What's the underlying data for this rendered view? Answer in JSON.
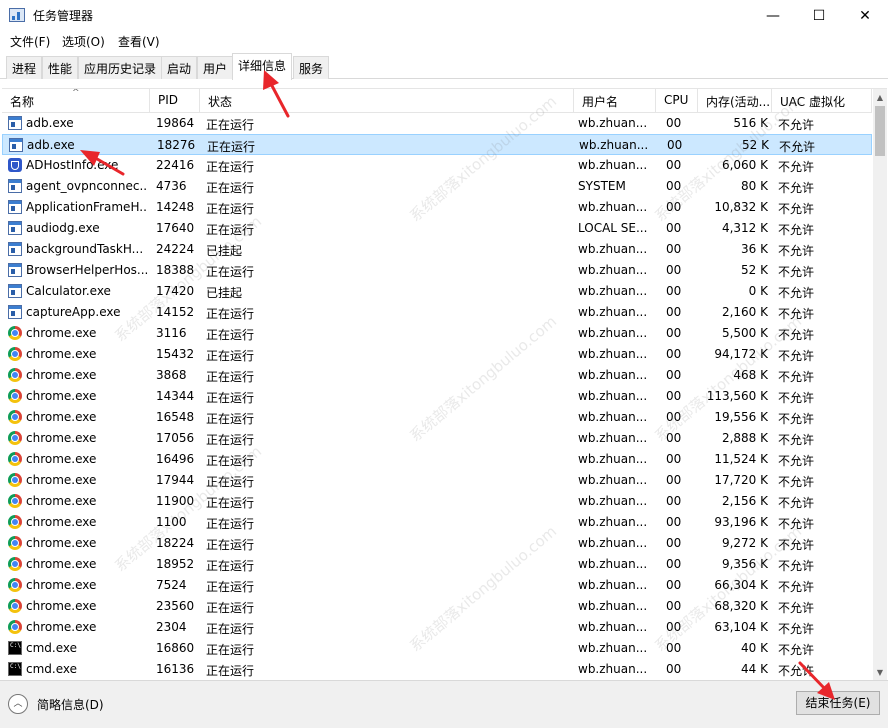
{
  "window": {
    "title": "任务管理器",
    "minimize_glyph": "—",
    "maximize_glyph": "☐",
    "close_glyph": "✕"
  },
  "menu": [
    "文件(F)",
    "选项(O)",
    "查看(V)"
  ],
  "tabs": [
    "进程",
    "性能",
    "应用历史记录",
    "启动",
    "用户",
    "详细信息",
    "服务"
  ],
  "active_tab": "详细信息",
  "columns": [
    "名称",
    "PID",
    "状态",
    "用户名",
    "CPU",
    "内存(活动...",
    "UAC 虚拟化"
  ],
  "selected_row": 1,
  "processes": [
    {
      "name": "adb.exe",
      "pid": "19864",
      "status": "正在运行",
      "user": "wb.zhuan...",
      "cpu": "00",
      "mem": "516 K",
      "uac": "不允许",
      "icon": "window-icon"
    },
    {
      "name": "adb.exe",
      "pid": "18276",
      "status": "正在运行",
      "user": "wb.zhuan...",
      "cpu": "00",
      "mem": "52 K",
      "uac": "不允许",
      "icon": "window-icon"
    },
    {
      "name": "ADHostInfo.exe",
      "pid": "22416",
      "status": "正在运行",
      "user": "wb.zhuan...",
      "cpu": "00",
      "mem": "6,060 K",
      "uac": "不允许",
      "icon": "shield-icon"
    },
    {
      "name": "agent_ovpnconnec...",
      "pid": "4736",
      "status": "正在运行",
      "user": "SYSTEM",
      "cpu": "00",
      "mem": "80 K",
      "uac": "不允许",
      "icon": "window-icon"
    },
    {
      "name": "ApplicationFrameH...",
      "pid": "14248",
      "status": "正在运行",
      "user": "wb.zhuan...",
      "cpu": "00",
      "mem": "10,832 K",
      "uac": "不允许",
      "icon": "window-icon"
    },
    {
      "name": "audiodg.exe",
      "pid": "17640",
      "status": "正在运行",
      "user": "LOCAL SE...",
      "cpu": "00",
      "mem": "4,312 K",
      "uac": "不允许",
      "icon": "window-icon"
    },
    {
      "name": "backgroundTaskH...",
      "pid": "24224",
      "status": "已挂起",
      "user": "wb.zhuan...",
      "cpu": "00",
      "mem": "36 K",
      "uac": "不允许",
      "icon": "window-icon"
    },
    {
      "name": "BrowserHelperHos...",
      "pid": "18388",
      "status": "正在运行",
      "user": "wb.zhuan...",
      "cpu": "00",
      "mem": "52 K",
      "uac": "不允许",
      "icon": "window-icon"
    },
    {
      "name": "Calculator.exe",
      "pid": "17420",
      "status": "已挂起",
      "user": "wb.zhuan...",
      "cpu": "00",
      "mem": "0 K",
      "uac": "不允许",
      "icon": "window-icon"
    },
    {
      "name": "captureApp.exe",
      "pid": "14152",
      "status": "正在运行",
      "user": "wb.zhuan...",
      "cpu": "00",
      "mem": "2,160 K",
      "uac": "不允许",
      "icon": "window-icon"
    },
    {
      "name": "chrome.exe",
      "pid": "3116",
      "status": "正在运行",
      "user": "wb.zhuan...",
      "cpu": "00",
      "mem": "5,500 K",
      "uac": "不允许",
      "icon": "chrome-icon"
    },
    {
      "name": "chrome.exe",
      "pid": "15432",
      "status": "正在运行",
      "user": "wb.zhuan...",
      "cpu": "00",
      "mem": "94,172 K",
      "uac": "不允许",
      "icon": "chrome-icon"
    },
    {
      "name": "chrome.exe",
      "pid": "3868",
      "status": "正在运行",
      "user": "wb.zhuan...",
      "cpu": "00",
      "mem": "468 K",
      "uac": "不允许",
      "icon": "chrome-icon"
    },
    {
      "name": "chrome.exe",
      "pid": "14344",
      "status": "正在运行",
      "user": "wb.zhuan...",
      "cpu": "00",
      "mem": "113,560 K",
      "uac": "不允许",
      "icon": "chrome-icon"
    },
    {
      "name": "chrome.exe",
      "pid": "16548",
      "status": "正在运行",
      "user": "wb.zhuan...",
      "cpu": "00",
      "mem": "19,556 K",
      "uac": "不允许",
      "icon": "chrome-icon"
    },
    {
      "name": "chrome.exe",
      "pid": "17056",
      "status": "正在运行",
      "user": "wb.zhuan...",
      "cpu": "00",
      "mem": "2,888 K",
      "uac": "不允许",
      "icon": "chrome-icon"
    },
    {
      "name": "chrome.exe",
      "pid": "16496",
      "status": "正在运行",
      "user": "wb.zhuan...",
      "cpu": "00",
      "mem": "11,524 K",
      "uac": "不允许",
      "icon": "chrome-icon"
    },
    {
      "name": "chrome.exe",
      "pid": "17944",
      "status": "正在运行",
      "user": "wb.zhuan...",
      "cpu": "00",
      "mem": "17,720 K",
      "uac": "不允许",
      "icon": "chrome-icon"
    },
    {
      "name": "chrome.exe",
      "pid": "11900",
      "status": "正在运行",
      "user": "wb.zhuan...",
      "cpu": "00",
      "mem": "2,156 K",
      "uac": "不允许",
      "icon": "chrome-icon"
    },
    {
      "name": "chrome.exe",
      "pid": "1100",
      "status": "正在运行",
      "user": "wb.zhuan...",
      "cpu": "00",
      "mem": "93,196 K",
      "uac": "不允许",
      "icon": "chrome-icon"
    },
    {
      "name": "chrome.exe",
      "pid": "18224",
      "status": "正在运行",
      "user": "wb.zhuan...",
      "cpu": "00",
      "mem": "9,272 K",
      "uac": "不允许",
      "icon": "chrome-icon"
    },
    {
      "name": "chrome.exe",
      "pid": "18952",
      "status": "正在运行",
      "user": "wb.zhuan...",
      "cpu": "00",
      "mem": "9,356 K",
      "uac": "不允许",
      "icon": "chrome-icon"
    },
    {
      "name": "chrome.exe",
      "pid": "7524",
      "status": "正在运行",
      "user": "wb.zhuan...",
      "cpu": "00",
      "mem": "66,304 K",
      "uac": "不允许",
      "icon": "chrome-icon"
    },
    {
      "name": "chrome.exe",
      "pid": "23560",
      "status": "正在运行",
      "user": "wb.zhuan...",
      "cpu": "00",
      "mem": "68,320 K",
      "uac": "不允许",
      "icon": "chrome-icon"
    },
    {
      "name": "chrome.exe",
      "pid": "2304",
      "status": "正在运行",
      "user": "wb.zhuan...",
      "cpu": "00",
      "mem": "63,104 K",
      "uac": "不允许",
      "icon": "chrome-icon"
    },
    {
      "name": "cmd.exe",
      "pid": "16860",
      "status": "正在运行",
      "user": "wb.zhuan...",
      "cpu": "00",
      "mem": "40 K",
      "uac": "不允许",
      "icon": "cmd-icon"
    },
    {
      "name": "cmd.exe",
      "pid": "16136",
      "status": "正在运行",
      "user": "wb.zhuan...",
      "cpu": "00",
      "mem": "44 K",
      "uac": "不允许",
      "icon": "cmd-icon"
    }
  ],
  "footer": {
    "fewer_details_label": "简略信息(D)",
    "end_task_label": "结束任务(E)"
  },
  "watermark_text": "系统部落xitongbuluo.com",
  "colors": {
    "selection": "#cce8ff",
    "selection_border": "#99d1ff",
    "annotation_arrow": "#e8262b"
  }
}
